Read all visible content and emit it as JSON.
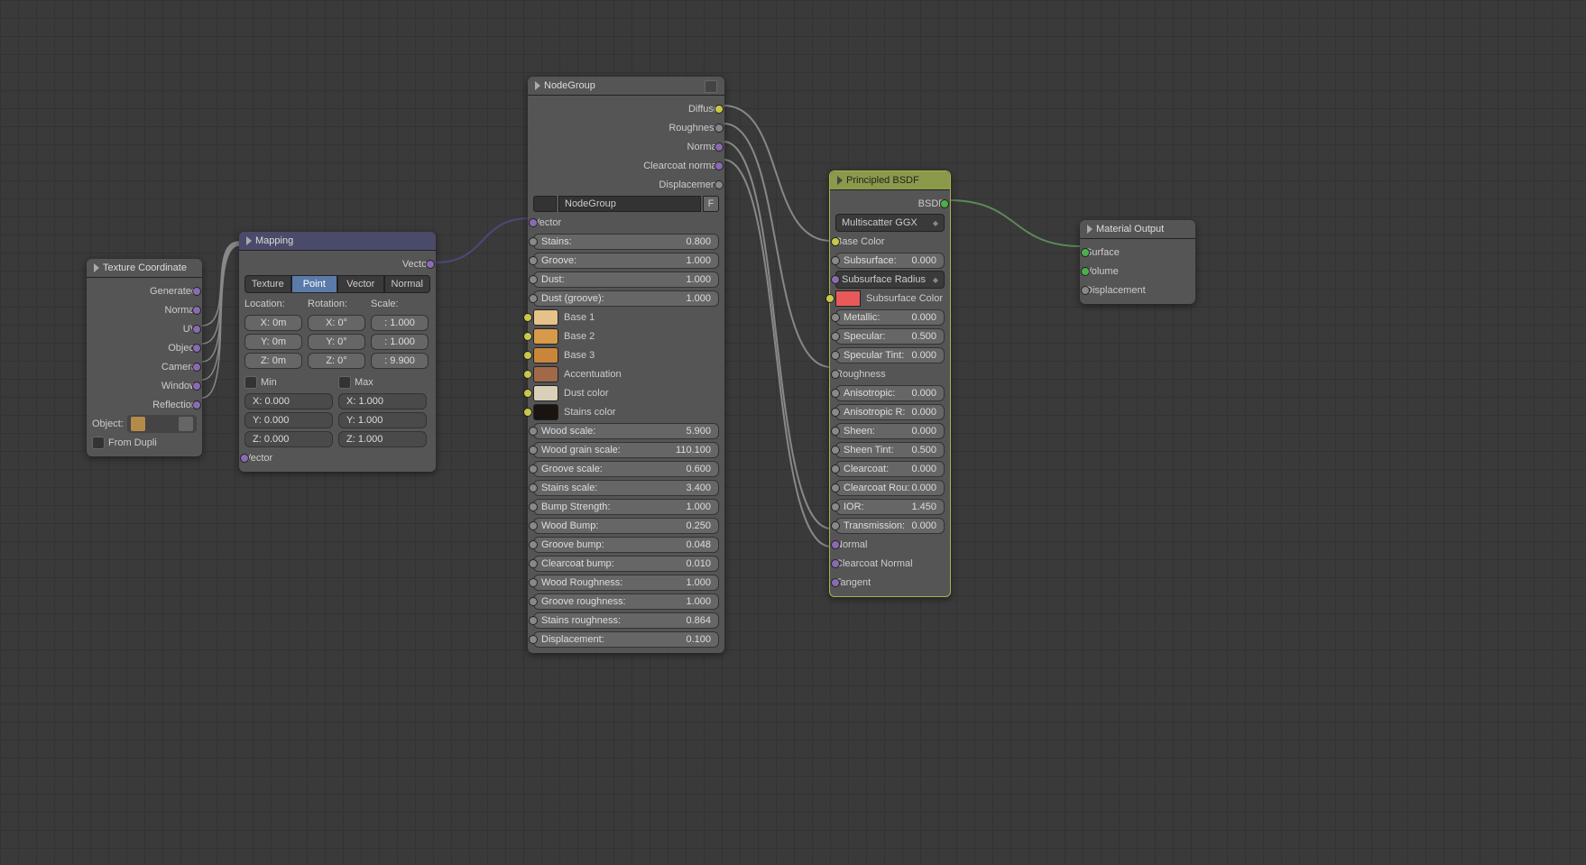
{
  "texcoord": {
    "title": "Texture Coordinate",
    "outs": [
      "Generated",
      "Normal",
      "UV",
      "Object",
      "Camera",
      "Window",
      "Reflection"
    ],
    "object_label": "Object:",
    "from_dupli": "From Dupli"
  },
  "mapping": {
    "title": "Mapping",
    "out": "Vector",
    "tabs": [
      "Texture",
      "Point",
      "Vector",
      "Normal"
    ],
    "cols": [
      "Location:",
      "Rotation:",
      "Scale:"
    ],
    "loc": [
      "X:   0m",
      "Y:   0m",
      "Z:   0m"
    ],
    "rot": [
      "X:    0°",
      "Y:    0°",
      "Z:    0°"
    ],
    "scl": [
      ": 1.000",
      ": 1.000",
      ": 9.900"
    ],
    "min": "Min",
    "max": "Max",
    "minv": [
      "X:        0.000",
      "Y:        0.000",
      "Z:        0.000"
    ],
    "maxv": [
      "X:        1.000",
      "Y:        1.000",
      "Z:        1.000"
    ],
    "in": "Vector"
  },
  "ng": {
    "title": "NodeGroup",
    "outs": [
      "Diffuse",
      "Roughness",
      "Normal",
      "Clearcoat normal",
      "Displacement"
    ],
    "name": "NodeGroup",
    "f": "F",
    "vector": "Vector",
    "p": [
      {
        "l": "Stains:",
        "r": "0.800"
      },
      {
        "l": "Groove:",
        "r": "1.000"
      },
      {
        "l": "Dust:",
        "r": "1.000"
      },
      {
        "l": "Dust (groove):",
        "r": "1.000"
      }
    ],
    "colors": [
      {
        "l": "Base 1",
        "c": "#e6c28a"
      },
      {
        "l": "Base 2",
        "c": "#d69a4a"
      },
      {
        "l": "Base 3",
        "c": "#c8863a"
      },
      {
        "l": "Accentuation",
        "c": "#a06a4a"
      },
      {
        "l": "Dust color",
        "c": "#d8d0b8"
      },
      {
        "l": "Stains color",
        "c": "#1a1410"
      }
    ],
    "p2": [
      {
        "l": "Wood scale:",
        "r": "5.900"
      },
      {
        "l": "Wood grain scale:",
        "r": "110.100"
      },
      {
        "l": "Groove scale:",
        "r": "0.600"
      },
      {
        "l": "Stains scale:",
        "r": "3.400"
      },
      {
        "l": "Bump Strength:",
        "r": "1.000"
      },
      {
        "l": "Wood Bump:",
        "r": "0.250"
      },
      {
        "l": "Groove bump:",
        "r": "0.048"
      },
      {
        "l": "Clearcoat bump:",
        "r": "0.010"
      },
      {
        "l": "Wood Roughness:",
        "r": "1.000"
      },
      {
        "l": "Groove roughness:",
        "r": "1.000"
      },
      {
        "l": "Stains roughness:",
        "r": "0.864"
      },
      {
        "l": "Displacement:",
        "r": "0.100"
      }
    ]
  },
  "bsdf": {
    "title": "Principled BSDF",
    "out": "BSDF",
    "dist": "Multiscatter GGX",
    "basecolor": "Base Color",
    "ssr": "Subsurface Radius",
    "ssc": "Subsurface Color",
    "roughness": "Roughness",
    "normal": "Normal",
    "ccn": "Clearcoat Normal",
    "tangent": "Tangent",
    "p": [
      {
        "l": "Subsurface:",
        "r": "0.000"
      },
      {
        "l": "Metallic:",
        "r": "0.000"
      },
      {
        "l": "Specular:",
        "r": "0.500"
      },
      {
        "l": "Specular Tint:",
        "r": "0.000"
      },
      {
        "l": "Anisotropic:",
        "r": "0.000"
      },
      {
        "l": "Anisotropic R:",
        "r": "0.000"
      },
      {
        "l": "Sheen:",
        "r": "0.000"
      },
      {
        "l": "Sheen Tint:",
        "r": "0.500"
      },
      {
        "l": "Clearcoat:",
        "r": "0.000"
      },
      {
        "l": "Clearcoat Rou:",
        "r": "0.000"
      },
      {
        "l": "IOR:",
        "r": "1.450"
      },
      {
        "l": "Transmission:",
        "r": "0.000"
      }
    ]
  },
  "out": {
    "title": "Material Output",
    "ins": [
      "Surface",
      "Volume",
      "Displacement"
    ]
  }
}
